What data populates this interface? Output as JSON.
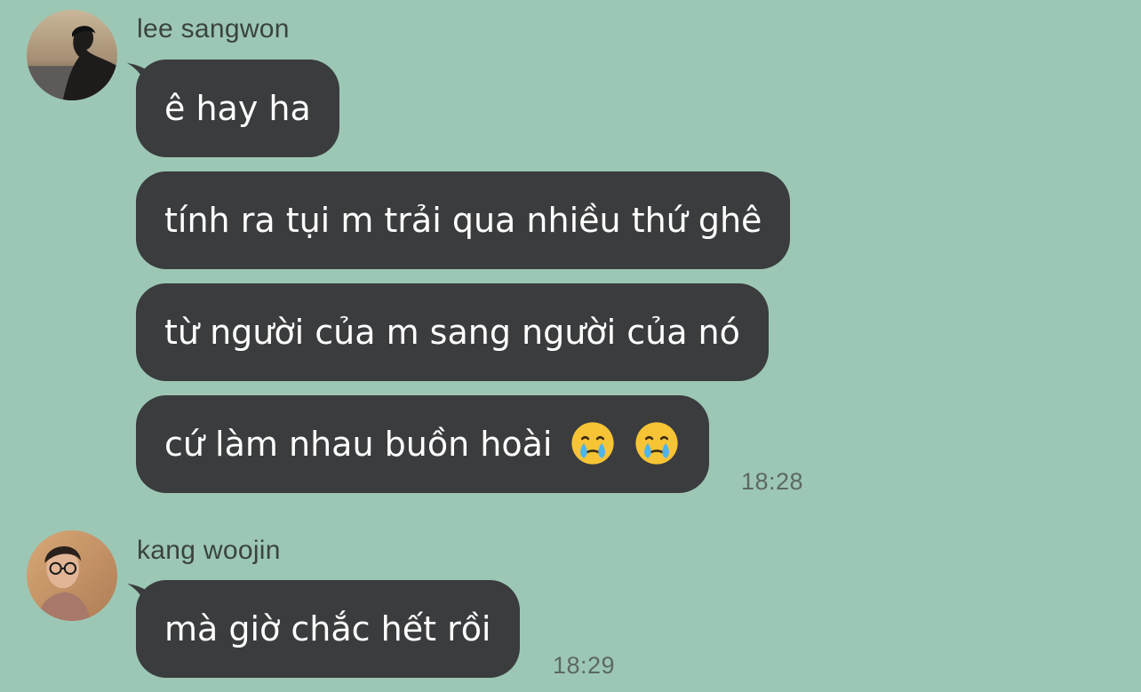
{
  "messages": [
    {
      "sender": "lee sangwon",
      "avatar_icon": "avatar-lee-sangwon",
      "bubbles": [
        "ê hay ha",
        "tính ra tụi m trải qua nhiều thứ ghê",
        "từ người của m sang người của nó",
        "cứ làm nhau buồn hoài"
      ],
      "emojis": [
        "face-holding-back-tears-icon",
        "face-holding-back-tears-icon"
      ],
      "time": "18:28"
    },
    {
      "sender": "kang woojin",
      "avatar_icon": "avatar-kang-woojin",
      "bubbles": [
        "mà giờ chắc hết rồi"
      ],
      "time": "18:29"
    }
  ],
  "colors": {
    "background": "#9dc7b5",
    "bubble": "#3a3c3e",
    "bubble_text": "#ffffff",
    "meta_text": "#5c6863"
  }
}
